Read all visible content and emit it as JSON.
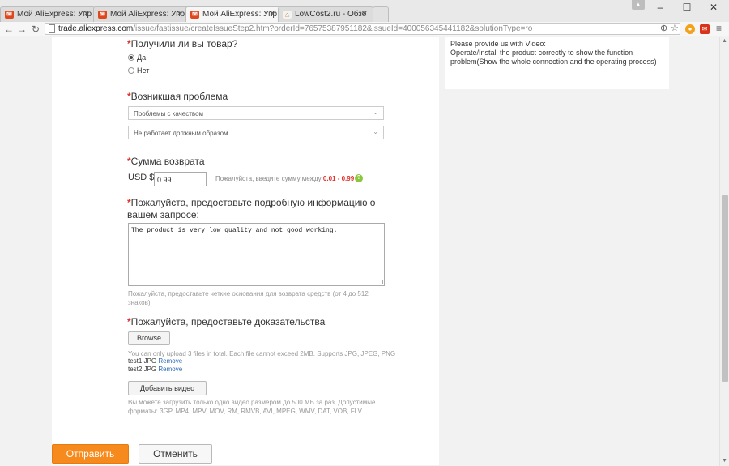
{
  "browser": {
    "tabs": [
      {
        "label": "Мой AliExpress: Упр",
        "favicon": "aliexpress-icon",
        "active": false
      },
      {
        "label": "Мой AliExpress: Упр",
        "favicon": "aliexpress-icon",
        "active": false
      },
      {
        "label": "Мой AliExpress: Упр",
        "favicon": "aliexpress-icon",
        "active": true
      },
      {
        "label": "LowCost2.ru - Обзо",
        "favicon": "lowcost-icon",
        "active": false
      }
    ],
    "url_host": "trade.aliexpress.com",
    "url_path": "/issue/fastissue/createIssueStep2.htm?orderId=76575387951182&issueId=400056345441182&solutionType=ro"
  },
  "side_note": {
    "line1": "Please provide us with Video:",
    "line2": "Operate/Install the product correctly to show the function problem(Show the whole connection and the operating process)"
  },
  "form": {
    "received": {
      "label": "Получили ли вы товар?",
      "options": [
        "Да",
        "Нет"
      ],
      "selected": "Да"
    },
    "problem": {
      "label": "Возникшая проблема",
      "select1": "Проблемы с качеством",
      "select2": "Не работает должным образом"
    },
    "refund": {
      "label": "Сумма возврата",
      "currency": "USD $",
      "value": "0.99",
      "hint": "Пожалуйста, введите сумму между",
      "range": "0.01 - 0.99"
    },
    "details": {
      "label": "Пожалуйста, предоставьте подробную информацию о вашем запросе:",
      "text": "The product is very low quality and not good working.",
      "hint": "Пожалуйста, предоставьте четкие основания для возврата средств (от 4 до 512 знаков)"
    },
    "evidence": {
      "label": "Пожалуйста, предоставьте доказательства",
      "browse": "Browse",
      "upload_note": "You can only upload 3 files in total. Each file cannot exceed 2MB. Supports JPG, JPEG, PNG",
      "files": [
        "test1.JPG",
        "test2.JPG"
      ],
      "remove": "Remove",
      "add_video": "Добавить видео",
      "video_note": "Вы можете загрузить только одно видео размером до 500 МБ за раз. Допустимые форматы: 3GP, MP4, MPV, MOV, RM, RMVB, AVI, MPEG, WMV, DAT, VOB, FLV."
    }
  },
  "actions": {
    "submit": "Отправить",
    "cancel": "Отменить"
  }
}
